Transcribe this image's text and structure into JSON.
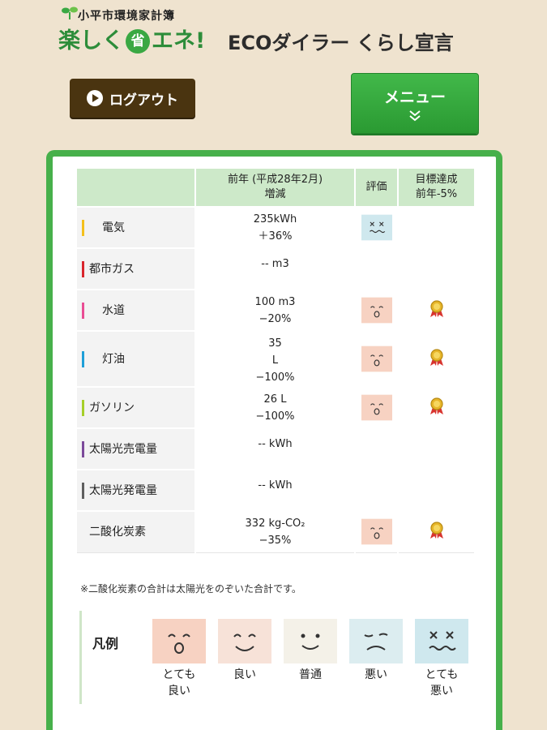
{
  "header": {
    "subtitle": "小平市環境家計簿",
    "brand_a": "楽しく",
    "brand_ring": "省",
    "brand_b": "エネ!",
    "tagline_eco": "ECO",
    "tagline_rest": "ダイラー くらし宣言"
  },
  "buttons": {
    "logout": "ログアウト",
    "menu": "メニュー",
    "menu_chevron": "»"
  },
  "table": {
    "headers": {
      "category": "",
      "change_line1": "前年 (平成28年2月)",
      "change_line2": "増減",
      "evaluation": "評価",
      "goal_line1": "目標達成",
      "goal_line2": "前年-5%"
    },
    "rows": [
      {
        "label": "電気",
        "color": "#f4c01c",
        "lines": [
          "235kWh",
          "＋36%"
        ],
        "face": "very-bad",
        "medal": false
      },
      {
        "label": "都市ガス",
        "color": "#d9262d",
        "lines": [
          "-- m3"
        ],
        "face": "",
        "medal": false
      },
      {
        "label": "水道",
        "color": "#e94d94",
        "lines": [
          "100 m3",
          "−20%"
        ],
        "face": "very-good",
        "medal": true
      },
      {
        "label": "灯油",
        "color": "#1e9fd8",
        "lines": [
          "35",
          "L",
          "−100%"
        ],
        "face": "very-good",
        "medal": true
      },
      {
        "label": "ガソリン",
        "color": "#a6cf29",
        "lines": [
          "26 L",
          "−100%"
        ],
        "face": "very-good",
        "medal": true
      },
      {
        "label": "太陽光売電量",
        "color": "#7c4a9a",
        "lines": [
          "-- kWh"
        ],
        "face": "",
        "medal": false
      },
      {
        "label": "太陽光発電量",
        "color": "#5e5e5e",
        "lines": [
          "-- kWh"
        ],
        "face": "",
        "medal": false
      },
      {
        "label": "二酸化炭素",
        "color": "",
        "lines": [
          "332 kg-CO₂",
          "−35%"
        ],
        "face": "very-good",
        "medal": true
      }
    ]
  },
  "note": "※二酸化炭素の合計は太陽光をのぞいた合計です。",
  "legend": {
    "title": "凡例",
    "items": [
      {
        "label1": "とても",
        "label2": "良い",
        "color": "#f7d2c2",
        "face": "very-good"
      },
      {
        "label1": "良い",
        "label2": "",
        "color": "#f7e2d8",
        "face": "good"
      },
      {
        "label1": "普通",
        "label2": "",
        "color": "#f4f1e8",
        "face": "normal"
      },
      {
        "label1": "悪い",
        "label2": "",
        "color": "#dcedf0",
        "face": "bad"
      },
      {
        "label1": "とても",
        "label2": "悪い",
        "color": "#cfe8ee",
        "face": "very-bad"
      }
    ]
  }
}
